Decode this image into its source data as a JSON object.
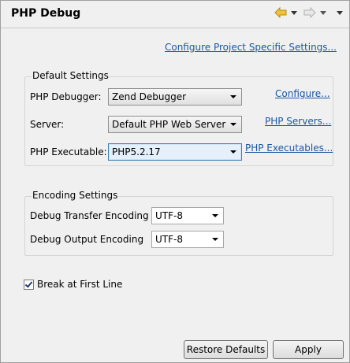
{
  "header": {
    "title": "PHP Debug"
  },
  "links": {
    "configure_project": "Configure Project Specific Settings...",
    "configure": "Configure...",
    "php_servers": "PHP Servers...",
    "php_executables": "PHP Executables..."
  },
  "default_settings": {
    "title": "Default Settings",
    "debugger_label": "PHP Debugger:",
    "debugger_value": "Zend Debugger",
    "server_label": "Server:",
    "server_value": "Default PHP Web Server",
    "executable_label": "PHP Executable:",
    "executable_value": "PHP5.2.17"
  },
  "encoding_settings": {
    "title": "Encoding Settings",
    "transfer_label": "Debug Transfer Encoding",
    "transfer_value": "UTF-8",
    "output_label": "Debug Output Encoding",
    "output_value": "UTF-8"
  },
  "options": {
    "break_first_line": "Break at First Line",
    "break_first_line_checked": true
  },
  "buttons": {
    "restore_defaults": "Restore Defaults",
    "apply": "Apply"
  },
  "colors": {
    "link": "#1c57a0",
    "focus_border": "#3c7fb1",
    "background": "#f0f0f0"
  }
}
